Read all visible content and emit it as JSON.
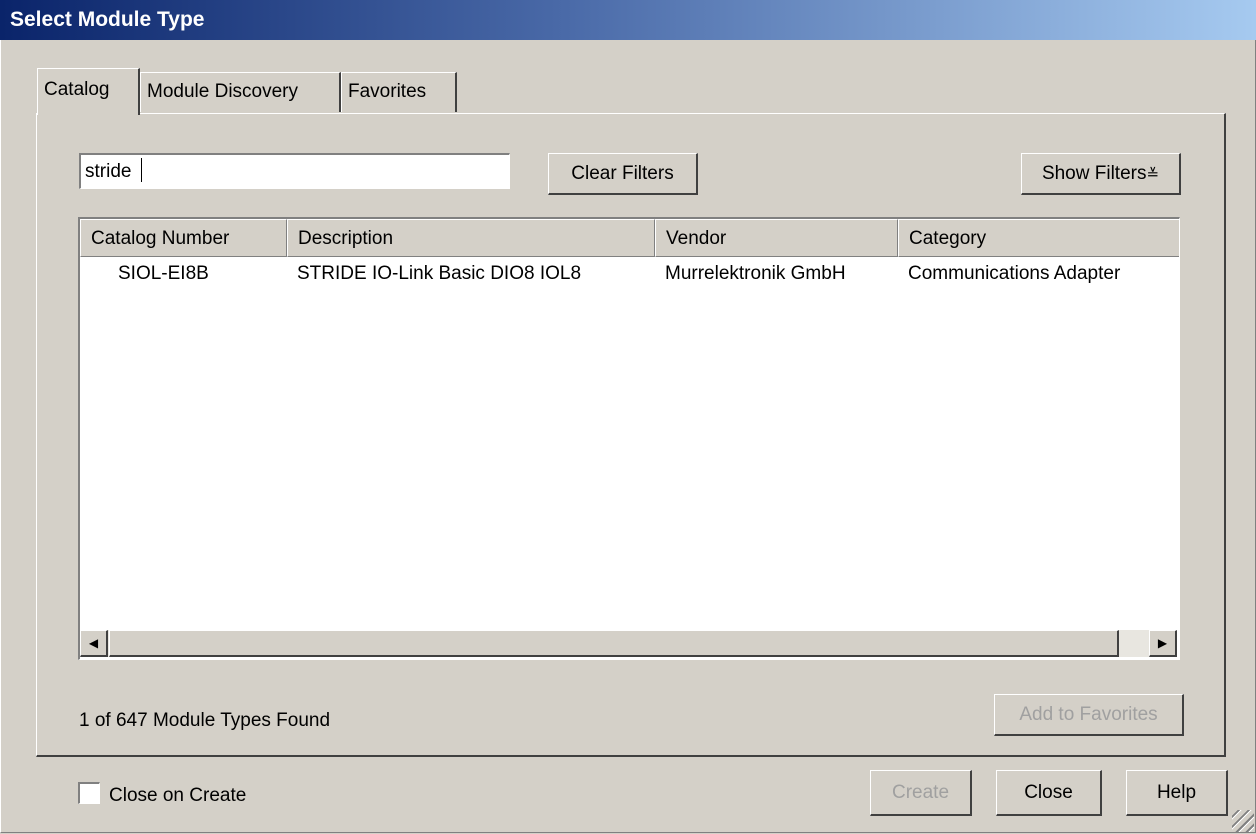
{
  "window": {
    "title": "Select Module Type"
  },
  "tabs": [
    {
      "label": "Catalog",
      "active": true
    },
    {
      "label": "Module Discovery",
      "active": false
    },
    {
      "label": "Favorites",
      "active": false
    }
  ],
  "search": {
    "value": "stride"
  },
  "buttons": {
    "clear_filters": "Clear Filters",
    "show_filters": "Show Filters",
    "show_filters_glyph": "≚",
    "add_to_favorites": "Add to Favorites",
    "create": "Create",
    "close": "Close",
    "help": "Help"
  },
  "table": {
    "columns": [
      "Catalog Number",
      "Description",
      "Vendor",
      "Category"
    ],
    "rows": [
      [
        "SIOL-EI8B",
        "STRIDE IO-Link Basic DIO8 IOL8",
        "Murrelektronik GmbH",
        "Communications Adapter"
      ]
    ]
  },
  "status": "1 of 647 Module Types Found",
  "close_on_create": {
    "label": "Close on Create",
    "checked": false
  },
  "icons": {
    "scroll_left": "◀",
    "scroll_right": "▶"
  },
  "colors": {
    "titlebar_start": "#0a246a",
    "titlebar_end": "#a6caf0",
    "face": "#d4d0c8"
  }
}
